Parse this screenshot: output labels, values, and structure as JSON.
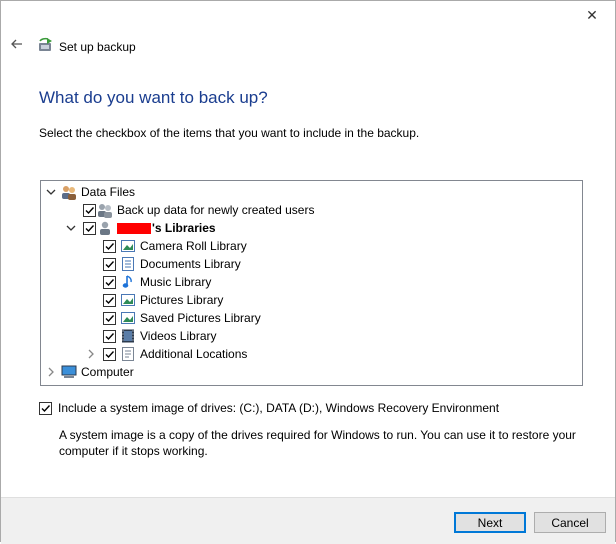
{
  "window": {
    "close_glyph": "✕"
  },
  "header": {
    "title": "Set up backup"
  },
  "page": {
    "heading": "What do you want to back up?",
    "instruction": "Select the checkbox of the items that you want to include in the backup."
  },
  "tree": {
    "data_files": "Data Files",
    "new_users": "Back up data for newly created users",
    "user_libraries_suffix": "'s Libraries",
    "libraries": [
      {
        "label": "Camera Roll Library",
        "icon": "image-library-icon"
      },
      {
        "label": "Documents Library",
        "icon": "document-library-icon"
      },
      {
        "label": "Music Library",
        "icon": "music-library-icon"
      },
      {
        "label": "Pictures Library",
        "icon": "image-library-icon"
      },
      {
        "label": "Saved Pictures Library",
        "icon": "image-library-icon"
      },
      {
        "label": "Videos Library",
        "icon": "video-library-icon"
      }
    ],
    "additional": "Additional Locations",
    "computer": "Computer"
  },
  "system_image": {
    "label": "Include a system image of drives: (C:), DATA (D:), Windows Recovery Environment",
    "checked": true,
    "description": "A system image is a copy of the drives required for Windows to run. You can use it to restore your computer if it stops working."
  },
  "buttons": {
    "next": "Next",
    "cancel": "Cancel"
  },
  "colors": {
    "heading": "#1a3d8f",
    "accent": "#0078d7",
    "footer_bg": "#f0f0f0"
  }
}
